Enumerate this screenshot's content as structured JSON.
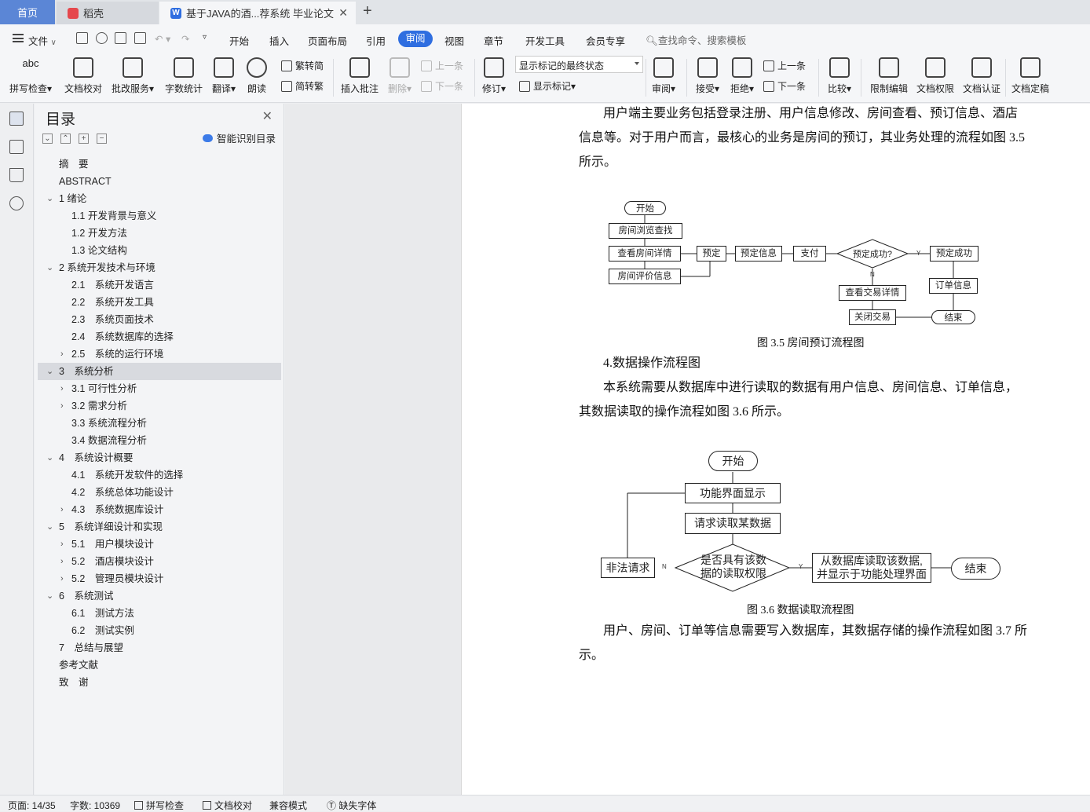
{
  "tabs": {
    "home": "首页",
    "straw": "稻壳",
    "doc": "基于JAVA的酒...荐系统 毕业论文",
    "doc_icon_letter": "W"
  },
  "menu": {
    "file": "文件",
    "items": [
      "开始",
      "插入",
      "页面布局",
      "引用",
      "审阅",
      "视图",
      "章节",
      "开发工具",
      "会员专享"
    ],
    "search": "查找命令、搜索模板"
  },
  "ribbon": {
    "spell": "拼写检查",
    "doc_proof": "文档校对",
    "batch": "批改服务",
    "wordcount": "字数统计",
    "translate": "翻译",
    "read": "朗读",
    "trad": "繁转简",
    "simp": "简转繁",
    "insert_comment": "插入批注",
    "delete": "删除",
    "prev": "上一条",
    "next": "下一条",
    "revise": "修订",
    "show_state": "显示标记的最终状态",
    "show_marks": "显示标记",
    "review": "审阅",
    "accept": "接受",
    "reject": "拒绝",
    "prev2": "上一条",
    "next2": "下一条",
    "compare": "比较",
    "restrict": "限制编辑",
    "perm": "文档权限",
    "auth": "文档认证",
    "final": "文档定稿",
    "abc": "abc"
  },
  "toc": {
    "title": "目录",
    "smart": "智能识别目录",
    "items": [
      {
        "t": "摘　要",
        "l": 1,
        "c": ""
      },
      {
        "t": "ABSTRACT",
        "l": 1,
        "c": ""
      },
      {
        "t": "1 绪论",
        "l": 1,
        "c": "v"
      },
      {
        "t": "1.1 开发背景与意义",
        "l": 2,
        "c": ""
      },
      {
        "t": "1.2 开发方法",
        "l": 2,
        "c": ""
      },
      {
        "t": "1.3 论文结构",
        "l": 2,
        "c": ""
      },
      {
        "t": "2 系统开发技术与环境",
        "l": 1,
        "c": "v"
      },
      {
        "t": "2.1　系统开发语言",
        "l": 2,
        "c": ""
      },
      {
        "t": "2.2　系统开发工具",
        "l": 2,
        "c": ""
      },
      {
        "t": "2.3　系统页面技术",
        "l": 2,
        "c": ""
      },
      {
        "t": "2.4　系统数据库的选择",
        "l": 2,
        "c": ""
      },
      {
        "t": "2.5　系统的运行环境",
        "l": 2,
        "c": ">"
      },
      {
        "t": "3　系统分析",
        "l": 1,
        "c": "v",
        "selected": true
      },
      {
        "t": "3.1 可行性分析",
        "l": 2,
        "c": ">"
      },
      {
        "t": "3.2 需求分析",
        "l": 2,
        "c": ">"
      },
      {
        "t": "3.3 系统流程分析",
        "l": 2,
        "c": ""
      },
      {
        "t": "3.4 数据流程分析",
        "l": 2,
        "c": ""
      },
      {
        "t": "4　系统设计概要",
        "l": 1,
        "c": "v"
      },
      {
        "t": "4.1　系统开发软件的选择",
        "l": 2,
        "c": ""
      },
      {
        "t": "4.2　系统总体功能设计",
        "l": 2,
        "c": ""
      },
      {
        "t": "4.3　系统数据库设计",
        "l": 2,
        "c": ">"
      },
      {
        "t": "5　系统详细设计和实现",
        "l": 1,
        "c": "v"
      },
      {
        "t": "5.1　用户模块设计",
        "l": 2,
        "c": ">"
      },
      {
        "t": "5.2　酒店模块设计",
        "l": 2,
        "c": ">"
      },
      {
        "t": "5.2　管理员模块设计",
        "l": 2,
        "c": ">"
      },
      {
        "t": "6　系统测试",
        "l": 1,
        "c": "v"
      },
      {
        "t": "6.1　测试方法",
        "l": 2,
        "c": ""
      },
      {
        "t": "6.2　测试实例",
        "l": 2,
        "c": ""
      },
      {
        "t": "7　总结与展望",
        "l": 1,
        "c": ""
      },
      {
        "t": "参考文献",
        "l": 1,
        "c": ""
      },
      {
        "t": "致　谢",
        "l": 1,
        "c": ""
      }
    ]
  },
  "doc": {
    "p1": "用户端主要业务包括登录注册、用户信息修改、房间查看、预订信息、酒店",
    "p1b": "信息等。对于用户而言，最核心的业务是房间的预订，其业务处理的流程如图 3.5",
    "p1c": "所示。",
    "fig35": {
      "start": "开始",
      "browse": "房间浏览查找",
      "detail": "查看房间详情",
      "review": "房间评价信息",
      "book": "预定",
      "bookinfo": "预定信息",
      "pay": "支付",
      "success_q": "预定成功?",
      "success": "预定成功",
      "order": "订单信息",
      "txdetail": "查看交易详情",
      "close": "关闭交易",
      "end": "结束",
      "y": "Y",
      "n": "N",
      "caption": "图 3.5  房间预订流程图"
    },
    "h4": "4.数据操作流程图",
    "p2": "本系统需要从数据库中进行读取的数据有用户信息、房间信息、订单信息，",
    "p2b": "其数据读取的操作流程如图 3.6 所示。",
    "fig36": {
      "start": "开始",
      "show": "功能界面显示",
      "req": "请求读取某数据",
      "perm1": "是否具有该数",
      "perm2": "据的读取权限",
      "illegal": "非法请求",
      "read1": "从数据库读取该数据,",
      "read2": "并显示于功能处理界面",
      "end": "结束",
      "y": "Y",
      "n": "N",
      "caption": "图 3.6  数据读取流程图"
    },
    "p3": "用户、房间、订单等信息需要写入数据库，其数据存储的操作流程如图 3.7 所",
    "p3b": "示。"
  },
  "status": {
    "page": "页面: 14/35",
    "words": "字数: 10369",
    "spell": "拼写检查",
    "proof": "文档校对",
    "compat": "兼容模式",
    "missing_font": "缺失字体"
  }
}
